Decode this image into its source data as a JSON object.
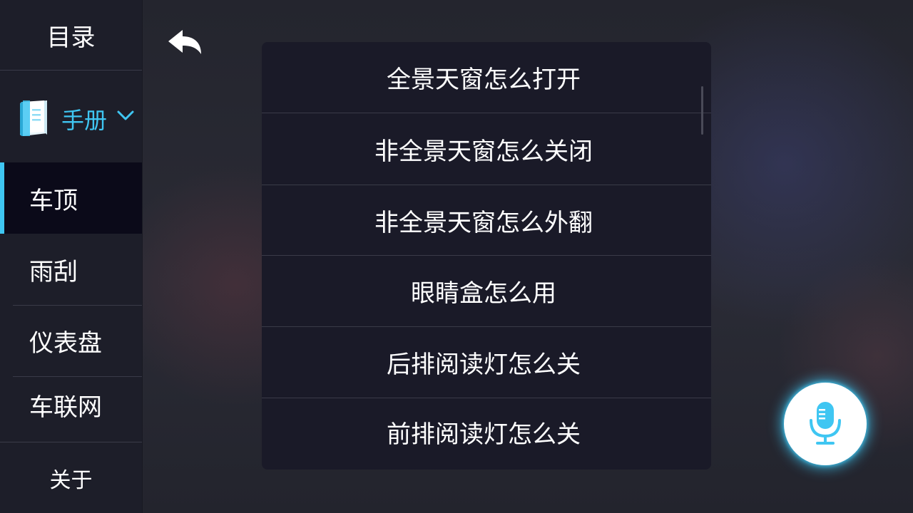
{
  "sidebar": {
    "title": "目录",
    "manual": {
      "label": "手册",
      "icon": "book-icon",
      "accent_color": "#3fc6f2"
    },
    "items": [
      {
        "label": "车顶",
        "active": true
      },
      {
        "label": "雨刮",
        "active": false
      },
      {
        "label": "仪表盘",
        "active": false
      },
      {
        "label": "车联网",
        "active": false
      }
    ],
    "about": "关于"
  },
  "header": {
    "back_icon": "back-arrow-icon"
  },
  "questions": [
    "全景天窗怎么打开",
    "非全景天窗怎么关闭",
    "非全景天窗怎么外翻",
    "眼睛盒怎么用",
    "后排阅读灯怎么关",
    "前排阅读灯怎么关"
  ],
  "voice": {
    "icon": "microphone-icon",
    "glow_color": "#3fc6f2"
  }
}
